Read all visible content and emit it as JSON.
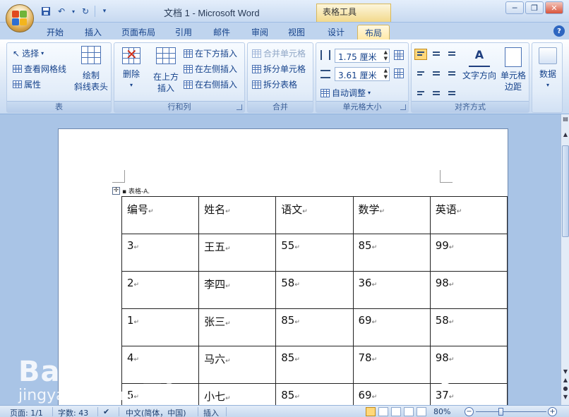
{
  "window": {
    "title": "文档 1 - Microsoft Word",
    "context_tab_group": "表格工具",
    "controls": [
      "minimize-icon",
      "restore-icon",
      "close-icon"
    ]
  },
  "quick_access": [
    "save-icon",
    "undo-icon",
    "redo-icon",
    "customize-icon"
  ],
  "tabs": [
    {
      "label": "开始",
      "active": false
    },
    {
      "label": "插入",
      "active": false
    },
    {
      "label": "页面布局",
      "active": false
    },
    {
      "label": "引用",
      "active": false
    },
    {
      "label": "邮件",
      "active": false
    },
    {
      "label": "审阅",
      "active": false
    },
    {
      "label": "视图",
      "active": false
    },
    {
      "label": "设计",
      "active": false
    },
    {
      "label": "布局",
      "active": true
    }
  ],
  "ribbon": {
    "table": {
      "label": "表",
      "select": "选择",
      "view_gridlines": "查看网格线",
      "properties": "属性",
      "draw_diagonal_line1": "绘制",
      "draw_diagonal_line2": "斜线表头"
    },
    "rows_cols": {
      "label": "行和列",
      "delete": "删除",
      "insert_above1": "在上方",
      "insert_above2": "插入",
      "insert_below": "在下方插入",
      "insert_left": "在左侧插入",
      "insert_right": "在右侧插入"
    },
    "merge": {
      "label": "合并",
      "merge_cells": "合并单元格",
      "split_cells": "拆分单元格",
      "split_table": "拆分表格"
    },
    "cell_size": {
      "label": "单元格大小",
      "height": "1.75 厘米",
      "width": "3.61 厘米",
      "autofit": "自动调整"
    },
    "alignment": {
      "label": "对齐方式",
      "text_direction": "文字方向",
      "cell_margins1": "单元格",
      "cell_margins2": "边距"
    },
    "data": {
      "label": "数据"
    }
  },
  "document": {
    "caption": "表格-A.",
    "table": {
      "headers": [
        "编号",
        "姓名",
        "语文",
        "数学",
        "英语"
      ],
      "rows": [
        [
          "3",
          "王五",
          "55",
          "85",
          "99"
        ],
        [
          "2",
          "李四",
          "58",
          "36",
          "98"
        ],
        [
          "1",
          "张三",
          "85",
          "69",
          "58"
        ],
        [
          "4",
          "马六",
          "85",
          "78",
          "98"
        ],
        [
          "5",
          "小七",
          "85",
          "69",
          "37"
        ]
      ]
    }
  },
  "status_bar": {
    "page": "页面: 1/1",
    "word_count": "字数: 43",
    "language": "中文(简体，中国)",
    "mode": "插入",
    "zoom": "80%",
    "zoom_percent": 80
  },
  "watermark": {
    "line1": "Bai du 经验",
    "line2": "jingyan.baidu.com"
  }
}
